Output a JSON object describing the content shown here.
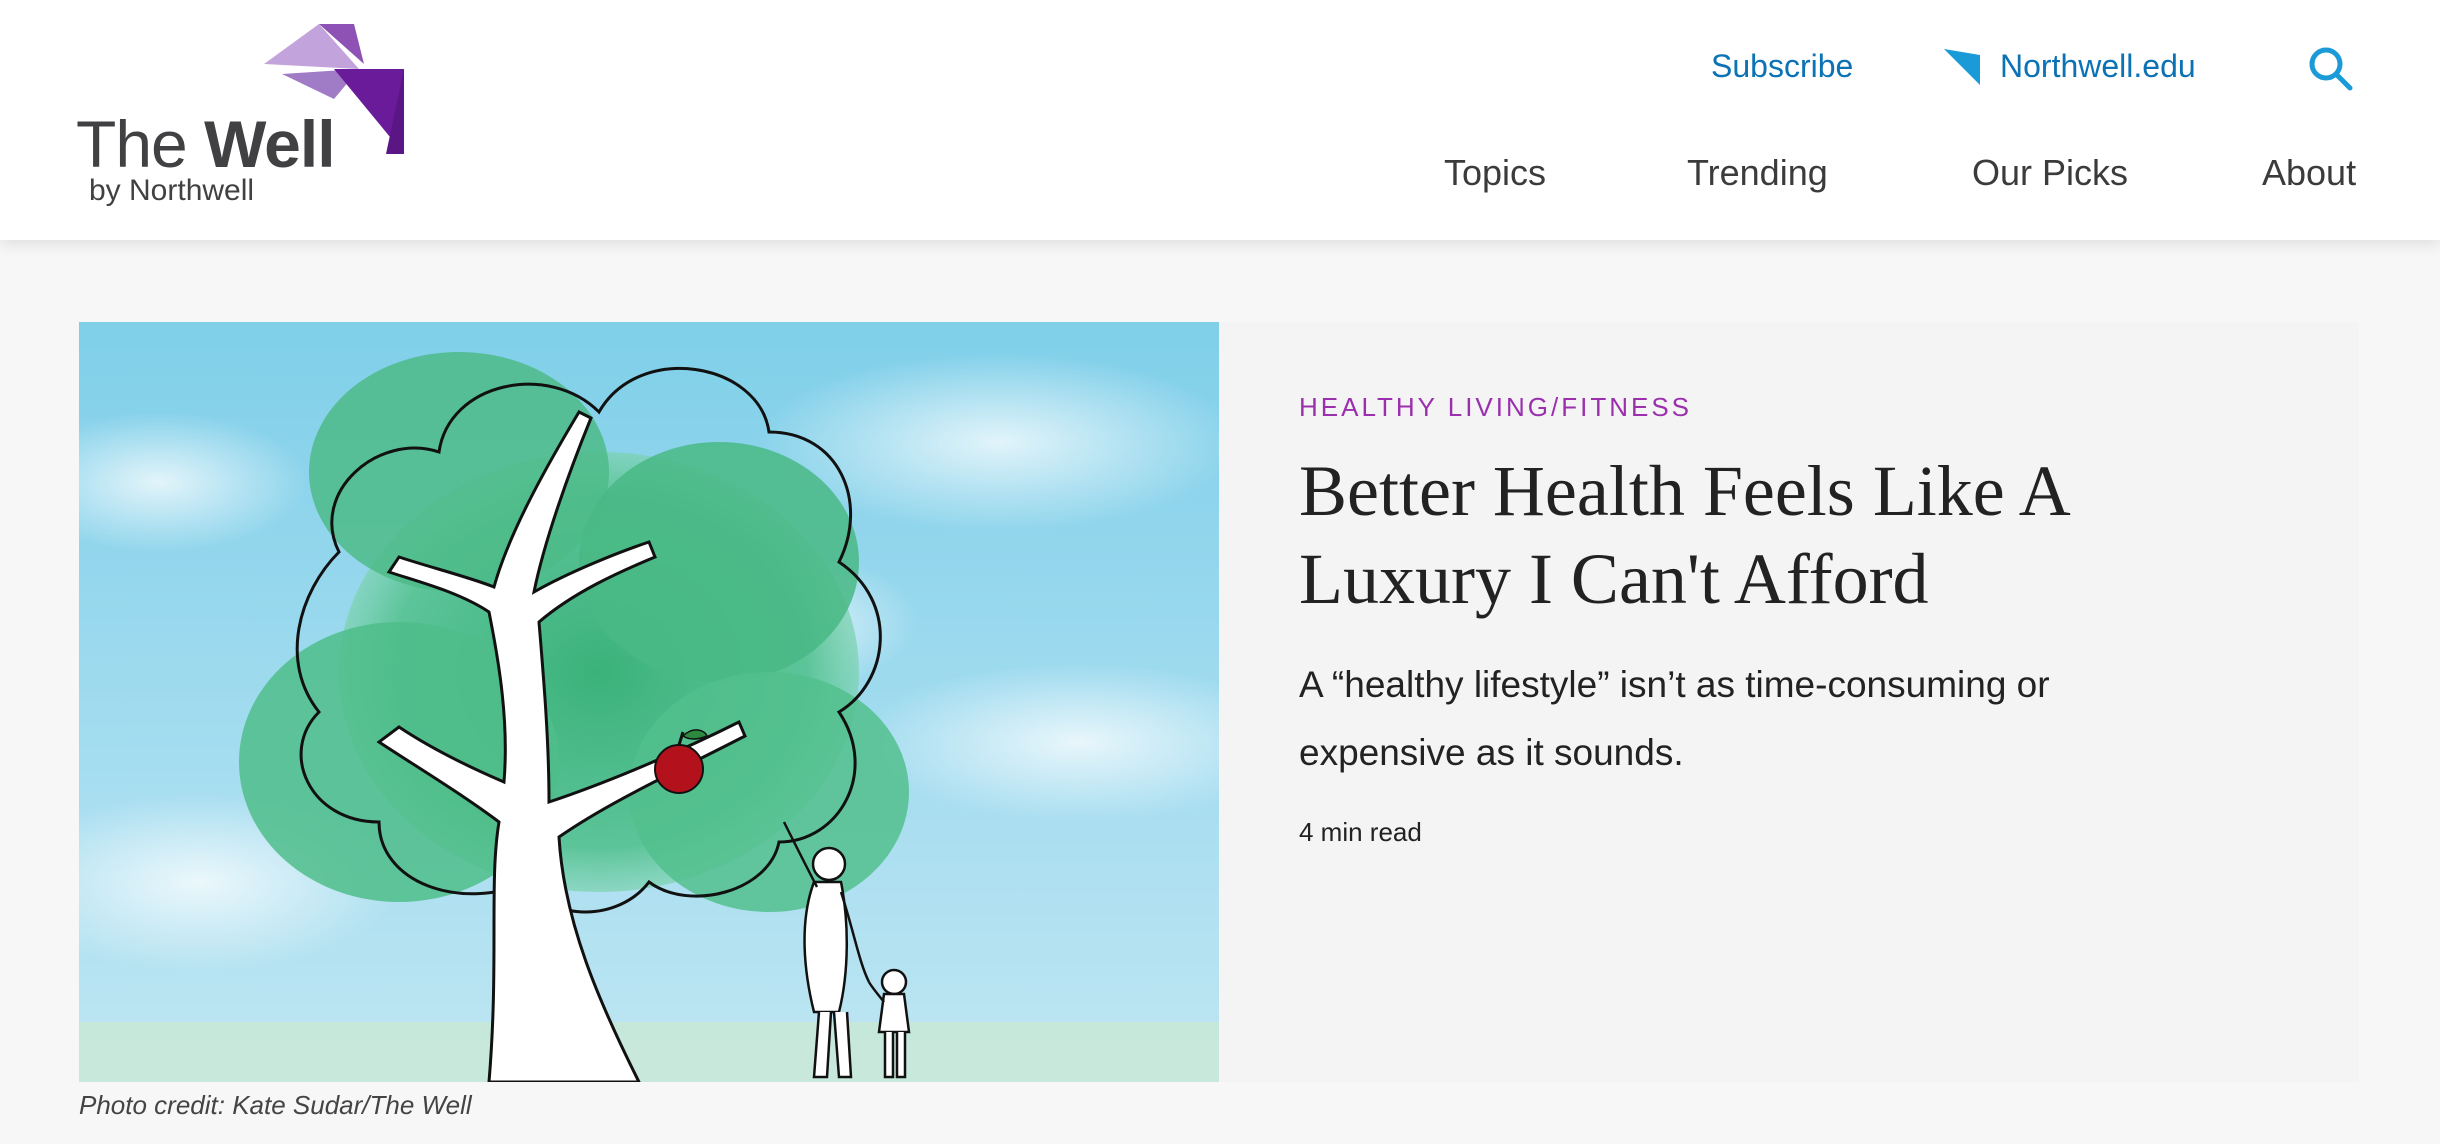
{
  "header": {
    "logo": {
      "word_light": "The ",
      "word_bold": "Well",
      "sub": "by Northwell"
    },
    "util_links": {
      "subscribe": "Subscribe",
      "northwell": "Northwell.edu",
      "search_icon": "search-icon"
    },
    "nav": {
      "topics": "Topics",
      "trending": "Trending",
      "picks": "Our Picks",
      "about": "About"
    }
  },
  "hero": {
    "category": "HEALTHY LIVING/FITNESS",
    "headline_line1": "Better Health Feels Like A",
    "headline_line2": "Luxury I Can't Afford",
    "dek_line1": "A “healthy lifestyle” isn’t as time-consuming or",
    "dek_line2": "expensive as it sounds.",
    "read_time": "4 min read",
    "image_alt": "Illustration of a tree with an apple and a parent and child reaching up"
  },
  "photo_credit": "Photo credit: Kate Sudar/The Well",
  "colors": {
    "link_blue": "#0a72b5",
    "category_purple": "#9b2fae",
    "logo_purple_dark": "#6a1b9a",
    "logo_purple_light": "#b48fd6"
  }
}
